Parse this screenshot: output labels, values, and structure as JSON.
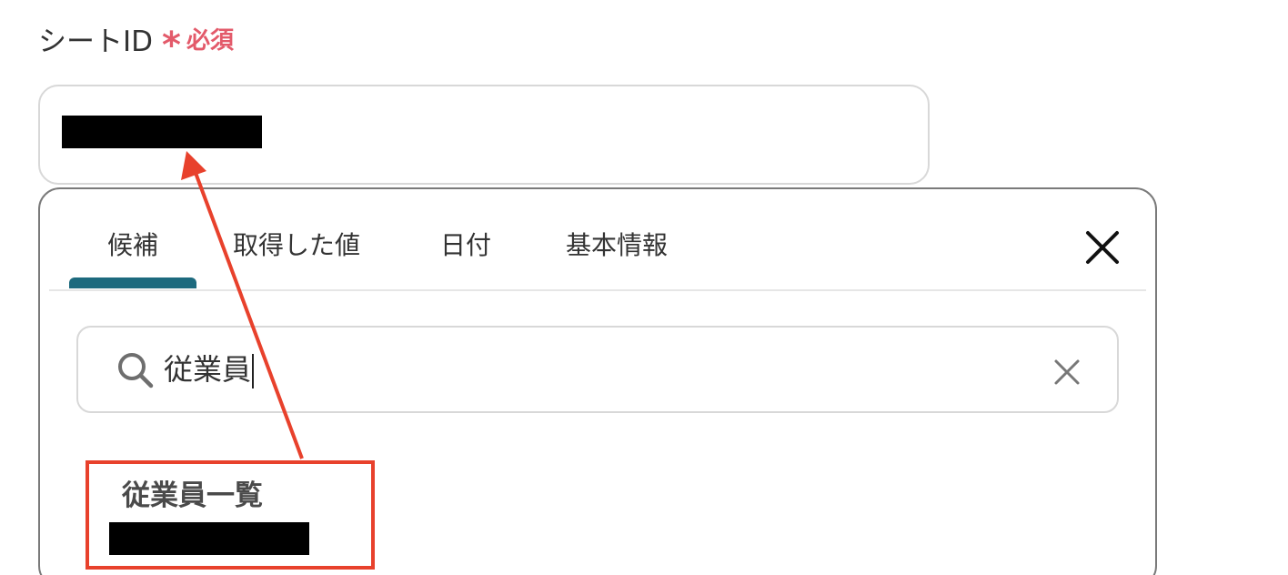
{
  "field": {
    "label": "シートID",
    "required_marker": "*",
    "required_text": "必須",
    "value_redacted": true
  },
  "popover": {
    "tabs": [
      {
        "label": "候補",
        "active": true
      },
      {
        "label": "取得した値",
        "active": false
      },
      {
        "label": "日付",
        "active": false
      },
      {
        "label": "基本情報",
        "active": false
      }
    ],
    "close_icon": "close-icon",
    "search": {
      "value": "従業員",
      "icon": "search-icon",
      "clear_icon": "clear-icon"
    },
    "results": [
      {
        "title": "従業員一覧",
        "id_redacted": true
      }
    ]
  },
  "colors": {
    "accent_tab": "#1d6a7e",
    "required": "#e35a6a",
    "annotation": "#e8412c"
  }
}
